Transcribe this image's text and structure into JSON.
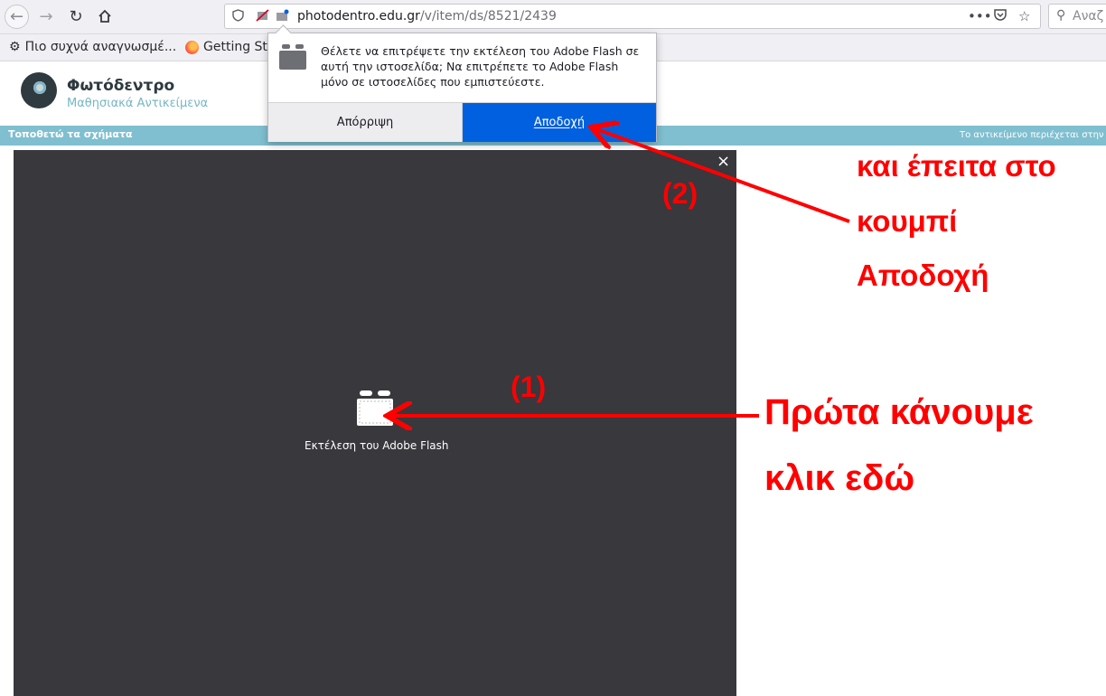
{
  "browser": {
    "url_domain": "photodentro.edu.gr",
    "url_path": "/v/item/ds/8521/2439",
    "search_placeholder": "Αναζ",
    "icons": [
      "back-icon",
      "forward-icon",
      "reload-icon",
      "home-icon",
      "shield-icon",
      "plugin-blocked-icon",
      "page-actions-icon",
      "pocket-icon",
      "bookmark-star-icon",
      "search-icon"
    ]
  },
  "bookmarks": {
    "most_visited": "Πιο συχνά αναγνωσμέ...",
    "getting_started": "Getting Sta"
  },
  "site": {
    "title": "Φωτόδεντρο",
    "subtitle": "Μαθησιακά Αντικείμενα",
    "bar_left": "Τοποθετώ τα σχήματα",
    "bar_right": "Το αντικείμενο περιέχεται στην συ"
  },
  "popup": {
    "message": "Θέλετε να επιτρέψετε την εκτέλεση του Adobe Flash σε αυτή την ιστοσελίδα; Να επιτρέπετε το Adobe Flash μόνο σε ιστοσελίδες που εμπιστεύεστε.",
    "reject_label": "Απόρριψη",
    "accept_label": "Αποδοχή",
    "accept_color": "#0060df"
  },
  "player": {
    "close_glyph": "×",
    "run_flash_label": "Εκτέλεση του Adobe Flash",
    "background": "#38383d"
  },
  "annotations": {
    "step1_number": "(1)",
    "step1_line1": "Πρώτα κάνουμε",
    "step1_line2": "κλικ εδώ",
    "step2_number": "(2)",
    "step2_line1": "και έπειτα στο",
    "step2_line2": "κουμπί",
    "step2_line3": "Αποδοχή",
    "color": "#ff0000"
  }
}
